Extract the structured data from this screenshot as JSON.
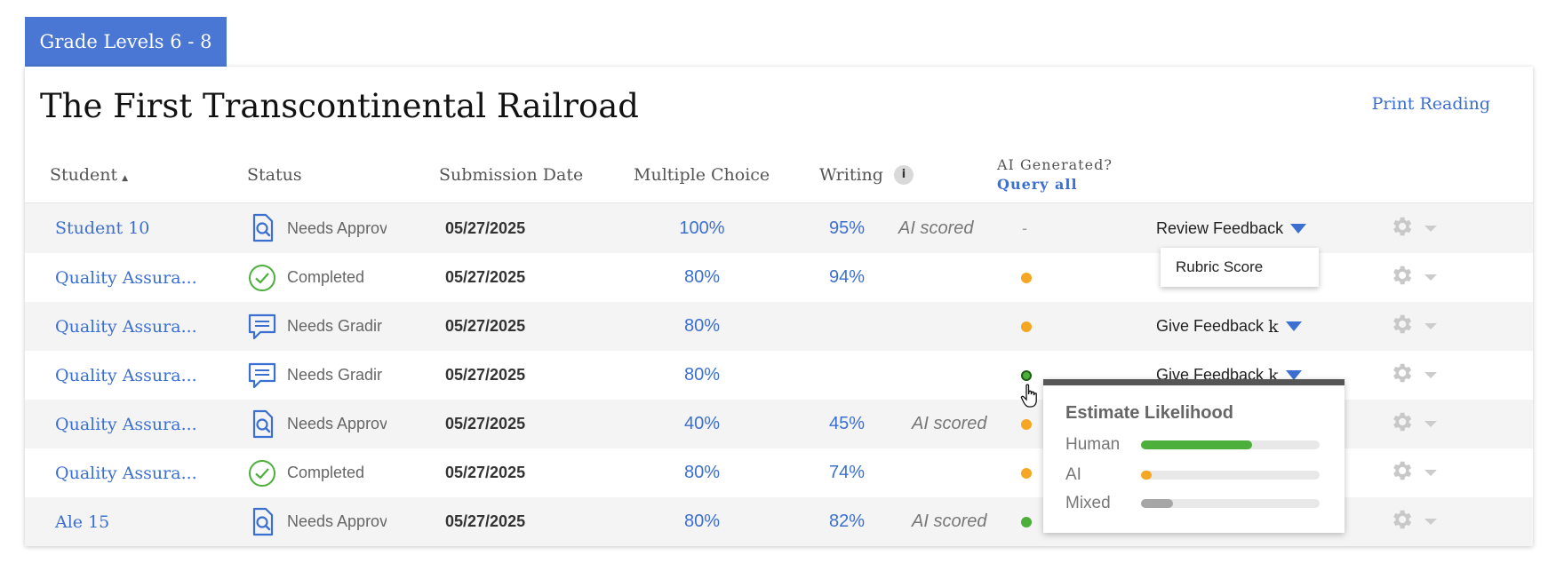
{
  "grade_tab": {
    "label": "Grade Levels 6 - 8"
  },
  "reading": {
    "title": "The First Transcontinental Railroad",
    "print_label": "Print Reading"
  },
  "table": {
    "headers": {
      "student": "Student",
      "status": "Status",
      "submission_date": "Submission Date",
      "multiple_choice": "Multiple Choice",
      "writing": "Writing",
      "info_icon": "i",
      "ai_generated": "AI Generated?",
      "query_all": "Query all"
    },
    "rows": [
      {
        "student": "Student 10",
        "status": "Needs Approval",
        "status_icon": "approval-search-icon",
        "date": "05/27/2025",
        "mc": "100%",
        "writing": "95%",
        "ai_scored": "AI scored",
        "ai_indicator": "-",
        "dot": "none",
        "action": "Review Feedback",
        "action_k": ""
      },
      {
        "student": "Quality Assura...",
        "status": "Completed",
        "status_icon": "check-circle-icon",
        "date": "05/27/2025",
        "mc": "80%",
        "writing": "94%",
        "ai_scored": "",
        "ai_indicator": "",
        "dot": "orange",
        "action": "",
        "action_k": ""
      },
      {
        "student": "Quality Assura...",
        "status": "Needs Gradir",
        "status_icon": "comment-icon",
        "date": "05/27/2025",
        "mc": "80%",
        "writing": "",
        "ai_scored": "",
        "ai_indicator": "",
        "dot": "orange",
        "action": "Give Feedback",
        "action_k": "k"
      },
      {
        "student": "Quality Assura...",
        "status": "Needs Gradir",
        "status_icon": "comment-icon",
        "date": "05/27/2025",
        "mc": "80%",
        "writing": "",
        "ai_scored": "",
        "ai_indicator": "",
        "dot": "green-outline",
        "action": "Give Feedback",
        "action_k": "k"
      },
      {
        "student": "Quality Assura...",
        "status": "Needs Approval",
        "status_icon": "approval-search-icon",
        "date": "05/27/2025",
        "mc": "40%",
        "writing": "45%",
        "ai_scored": "AI scored",
        "ai_indicator": "",
        "dot": "orange",
        "action": "",
        "action_k": ""
      },
      {
        "student": "Quality Assura...",
        "status": "Completed",
        "status_icon": "check-circle-icon",
        "date": "05/27/2025",
        "mc": "80%",
        "writing": "74%",
        "ai_scored": "",
        "ai_indicator": "",
        "dot": "orange",
        "action": "",
        "action_k": ""
      },
      {
        "student": "Ale 15",
        "status": "Needs Approval",
        "status_icon": "approval-search-icon",
        "date": "05/27/2025",
        "mc": "80%",
        "writing": "82%",
        "ai_scored": "AI scored",
        "ai_indicator": "",
        "dot": "green",
        "action": "",
        "action_k": ""
      }
    ]
  },
  "dropdown_menu": {
    "item": "Rubric Score"
  },
  "tooltip": {
    "title": "Estimate Likelihood",
    "rows": [
      {
        "label": "Human",
        "fraction": 0.62,
        "color": "#4cae3b"
      },
      {
        "label": "AI",
        "fraction": 0.06,
        "color": "#f5a623"
      },
      {
        "label": "Mixed",
        "fraction": 0.18,
        "color": "#a6a6a6"
      }
    ]
  },
  "colors": {
    "accent": "#3b6fd1",
    "tab_bg": "#4a77d4",
    "orange": "#f5a623",
    "green": "#4cae3b",
    "gear": "#c8c8c8"
  }
}
